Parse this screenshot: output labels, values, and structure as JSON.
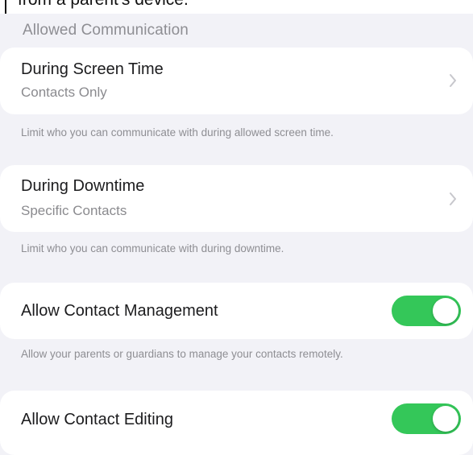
{
  "top": {
    "cut_text": "from a parent's device."
  },
  "section": {
    "header": "Allowed Communication"
  },
  "screen_time": {
    "title": "During Screen Time",
    "value": "Contacts Only",
    "footnote": "Limit who you can communicate with during allowed screen time."
  },
  "downtime": {
    "title": "During Downtime",
    "value": "Specific Contacts",
    "footnote": "Limit who you can communicate with during downtime."
  },
  "contact_management": {
    "title": "Allow Contact Management",
    "enabled": true,
    "footnote": "Allow your parents or guardians to manage your contacts remotely."
  },
  "contact_editing": {
    "title": "Allow Contact Editing",
    "enabled": true
  },
  "colors": {
    "background": "#f2f2f7",
    "toggle_on": "#34c759",
    "secondary_text": "#8e8e93"
  },
  "icons": [
    "chevron-right-icon"
  ]
}
